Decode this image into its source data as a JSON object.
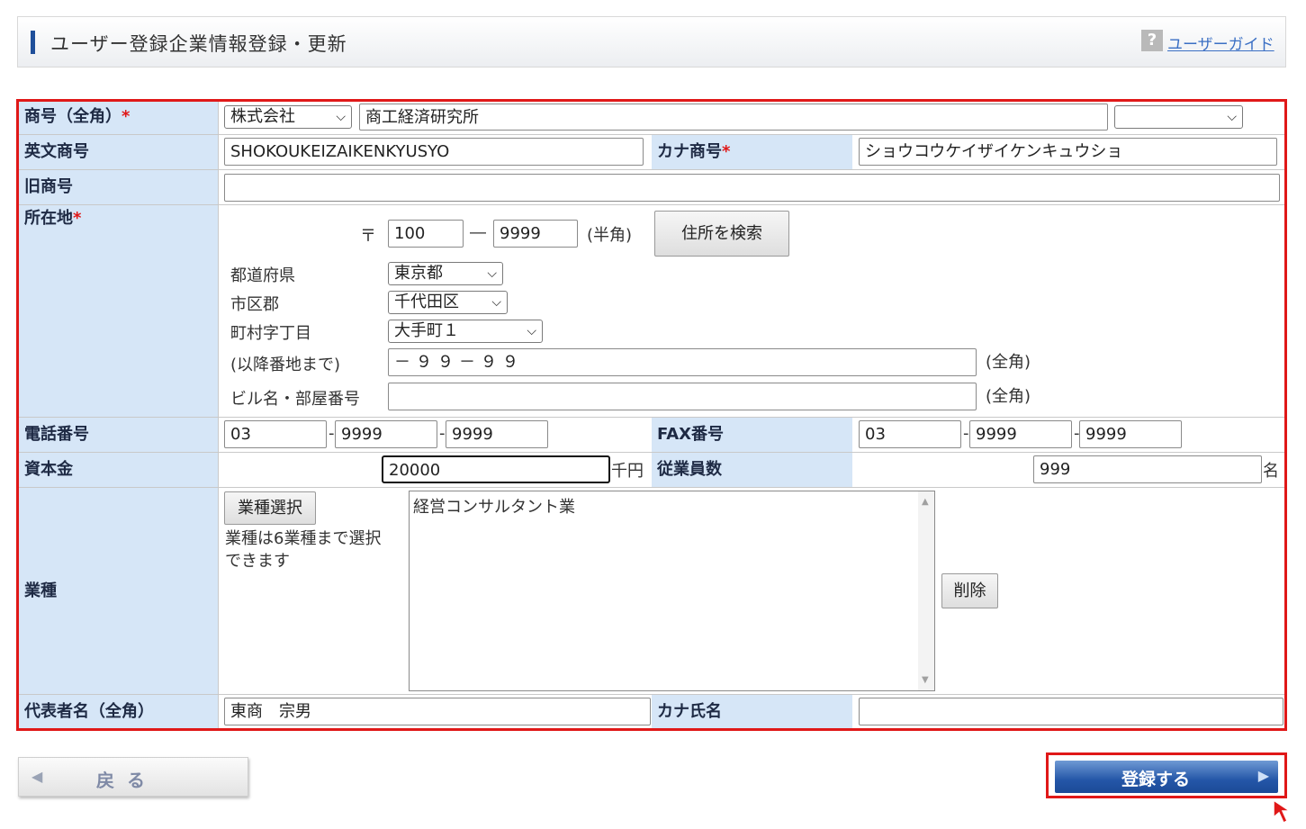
{
  "header": {
    "title": "ユーザー登録企業情報登録・更新",
    "help_glyph": "?",
    "guide_link": "ユーザーガイド"
  },
  "form": {
    "trade_name": {
      "label": "商号（全角）",
      "required_mark": "*",
      "prefix_select": "株式会社",
      "value": "商工経済研究所",
      "suffix_select": ""
    },
    "english_name": {
      "label": "英文商号",
      "value": "SHOKOUKEIZAIKENKYUSYO"
    },
    "kana_name": {
      "label": "カナ商号",
      "required_mark": "*",
      "value": "ショウコウケイザイケンキュウショ"
    },
    "old_name": {
      "label": "旧商号",
      "value": ""
    },
    "address": {
      "label": "所在地",
      "required_mark": "*",
      "postal_mark": "〒",
      "postal1": "100",
      "postal_dash": "―",
      "postal2": "9999",
      "postal_note": "(半角)",
      "search_button": "住所を検索",
      "prefecture_label": "都道府県",
      "prefecture_value": "東京都",
      "city_label": "市区郡",
      "city_value": "千代田区",
      "town_label": "町村字丁目",
      "town_value": "大手町１",
      "street_label": "(以降番地まで)",
      "street_value": "－９９－９９",
      "street_note": "(全角)",
      "building_label": "ビル名・部屋番号",
      "building_value": "",
      "building_note": "(全角)"
    },
    "phone": {
      "label": "電話番号",
      "p1": "03",
      "p2": "9999",
      "p3": "9999",
      "sep": "-"
    },
    "fax": {
      "label": "FAX番号",
      "p1": "03",
      "p2": "9999",
      "p3": "9999",
      "sep": "-"
    },
    "capital": {
      "label": "資本金",
      "value": "20000",
      "unit": "千円"
    },
    "employees": {
      "label": "従業員数",
      "value": "999",
      "unit": "名"
    },
    "industry": {
      "label": "業種",
      "select_button": "業種選択",
      "note": "業種は6業種まで選択できます",
      "list_value": "経営コンサルタント業",
      "delete_button": "削除"
    },
    "representative": {
      "label": "代表者名（全角）",
      "value": "東商　宗男"
    },
    "kana_rep": {
      "label": "カナ氏名",
      "value": ""
    }
  },
  "footer": {
    "back_button": "戻る",
    "back_arrow": "◀",
    "register_button": "登録する",
    "register_arrow": "▶"
  },
  "colors": {
    "accent_red": "#e01818",
    "label_bg": "#d6e6f7",
    "primary_blue": "#2456a8"
  }
}
